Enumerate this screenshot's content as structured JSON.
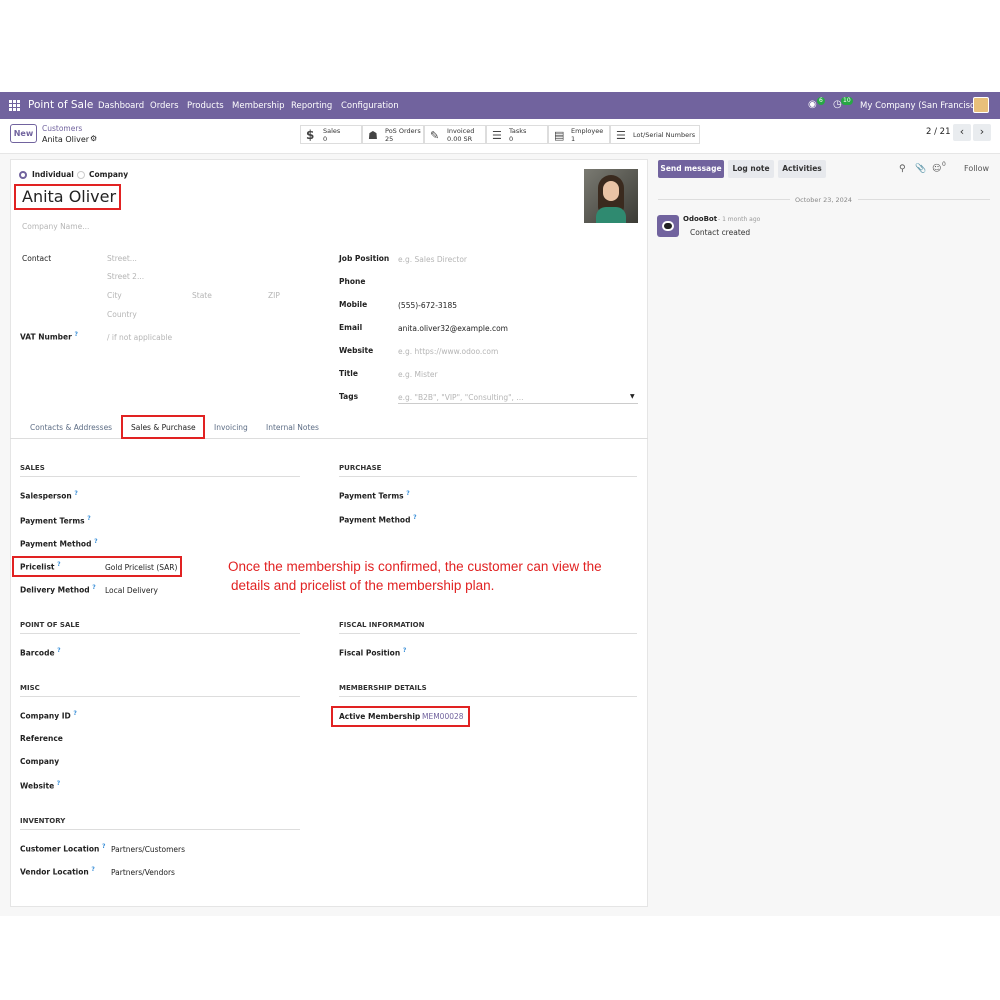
{
  "navbar": {
    "app_name": "Point of Sale",
    "menu": [
      "Dashboard",
      "Orders",
      "Products",
      "Membership",
      "Reporting",
      "Configuration"
    ],
    "messages_count": "6",
    "activities_count": "10",
    "company": "My Company (San Francisco)"
  },
  "control_panel": {
    "new_label": "New",
    "breadcrumb_parent": "Customers",
    "breadcrumb_current": "Anita Oliver",
    "smart_buttons": [
      {
        "label": "Sales",
        "value": "0",
        "icon": "dollar-icon"
      },
      {
        "label": "PoS Orders",
        "value": "25",
        "icon": "shop-icon"
      },
      {
        "label": "Invoiced",
        "value": "0.00 SR",
        "icon": "pencil-square-icon"
      },
      {
        "label": "Tasks",
        "value": "0",
        "icon": "tasks-icon"
      },
      {
        "label": "Employee",
        "value": "1",
        "icon": "id-card-icon"
      },
      {
        "label": "Lot/Serial Numbers",
        "value": "",
        "icon": "list-icon"
      }
    ],
    "pager": "2 / 21"
  },
  "form": {
    "type_individual": "Individual",
    "type_company": "Company",
    "name": "Anita Oliver",
    "company_name_placeholder": "Company Name...",
    "contact_label": "Contact",
    "street_placeholder": "Street...",
    "street2_placeholder": "Street 2...",
    "city_placeholder": "City",
    "state_placeholder": "State",
    "zip_placeholder": "ZIP",
    "country_placeholder": "Country",
    "vat_label": "VAT Number",
    "vat_placeholder": "/ if not applicable",
    "job_position_label": "Job Position",
    "job_position_placeholder": "e.g. Sales Director",
    "phone_label": "Phone",
    "mobile_label": "Mobile",
    "mobile_value": "(555)-672-3185",
    "email_label": "Email",
    "email_value": "anita.oliver32@example.com",
    "website_label": "Website",
    "website_placeholder": "e.g. https://www.odoo.com",
    "title_label": "Title",
    "title_placeholder": "e.g. Mister",
    "tags_label": "Tags",
    "tags_placeholder": "e.g. \"B2B\", \"VIP\", \"Consulting\", ..."
  },
  "tabs": [
    "Contacts & Addresses",
    "Sales & Purchase",
    "Invoicing",
    "Internal Notes"
  ],
  "sales": {
    "title": "SALES",
    "salesperson": "Salesperson",
    "payment_terms": "Payment Terms",
    "payment_method": "Payment Method",
    "pricelist_label": "Pricelist",
    "pricelist_value": "Gold Pricelist (SAR)",
    "delivery_method_label": "Delivery Method",
    "delivery_method_value": "Local Delivery"
  },
  "purchase": {
    "title": "PURCHASE",
    "payment_terms": "Payment Terms",
    "payment_method": "Payment Method"
  },
  "annotation": {
    "line1": "Once the membership is confirmed, the customer can view the",
    "line2": "details and pricelist of the membership plan."
  },
  "pos": {
    "title": "POINT OF SALE",
    "barcode": "Barcode"
  },
  "fiscal": {
    "title": "FISCAL INFORMATION",
    "fiscal_position": "Fiscal Position"
  },
  "misc": {
    "title": "MISC",
    "company_id": "Company ID",
    "reference": "Reference",
    "company": "Company",
    "website": "Website"
  },
  "membership": {
    "title": "MEMBERSHIP DETAILS",
    "active_label": "Active Membership",
    "active_value": "MEM00028"
  },
  "inventory": {
    "title": "INVENTORY",
    "customer_location_label": "Customer Location",
    "customer_location_value": "Partners/Customers",
    "vendor_location_label": "Vendor Location",
    "vendor_location_value": "Partners/Vendors"
  },
  "chatter": {
    "send_message": "Send message",
    "log_note": "Log note",
    "activities": "Activities",
    "followers_count": "0",
    "follow": "Follow",
    "date_separator": "October 23, 2024",
    "message_author": "OdooBot",
    "message_time": "- 1 month ago",
    "message_body": "Contact created"
  },
  "colors": {
    "brand": "#71639e",
    "annotation": "#e12222",
    "highlight_box": "#e12222"
  }
}
